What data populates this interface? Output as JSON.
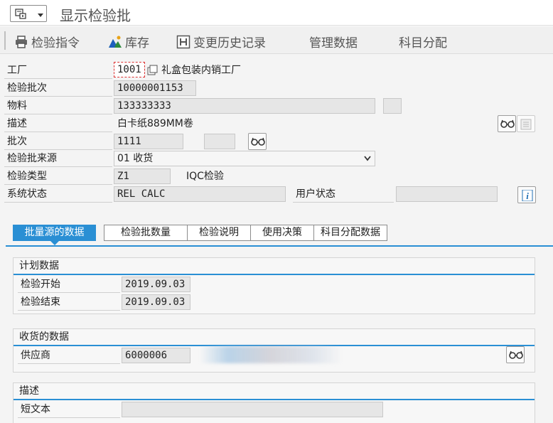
{
  "window": {
    "title": "显示检验批"
  },
  "toolbar": {
    "inspection_instruction": "检验指令",
    "inventory": "库存",
    "change_history": "变更历史记录",
    "manage_data": "管理数据",
    "account_assignment": "科目分配"
  },
  "header": {
    "plant_label": "工厂",
    "plant_value": "1001",
    "plant_desc": "礼盒包装内销工厂",
    "lot_label": "检验批次",
    "lot_value": "10000001153",
    "material_label": "物料",
    "material_value": "133333333",
    "desc_label": "描述",
    "desc_value": "白卡纸889MM卷",
    "batch_label": "批次",
    "batch_value": "1111",
    "origin_label": "检验批来源",
    "origin_value": "01 收货",
    "type_label": "检验类型",
    "type_value": "Z1",
    "type_desc": "IQC检验",
    "status_label": "系统状态",
    "status_value": "REL  CALC",
    "user_status_label": "用户状态",
    "user_status_value": ""
  },
  "tabs": [
    "批量源的数据",
    "检验批数量",
    "检验说明",
    "使用决策",
    "科目分配数据"
  ],
  "active_tab": "批量源的数据",
  "planned": {
    "title": "计划数据",
    "start_label": "检验开始",
    "start_value": "2019.09.03",
    "end_label": "检验结束",
    "end_value": "2019.09.03"
  },
  "receipt": {
    "title": "收货的数据",
    "vendor_label": "供应商",
    "vendor_value": "6000006"
  },
  "description": {
    "title": "描述",
    "short_text_label": "短文本",
    "short_text_value": ""
  },
  "colors": {
    "accent": "#2a8fd4",
    "field_bg": "#e6e6e6",
    "info": "#1f6fb5"
  }
}
